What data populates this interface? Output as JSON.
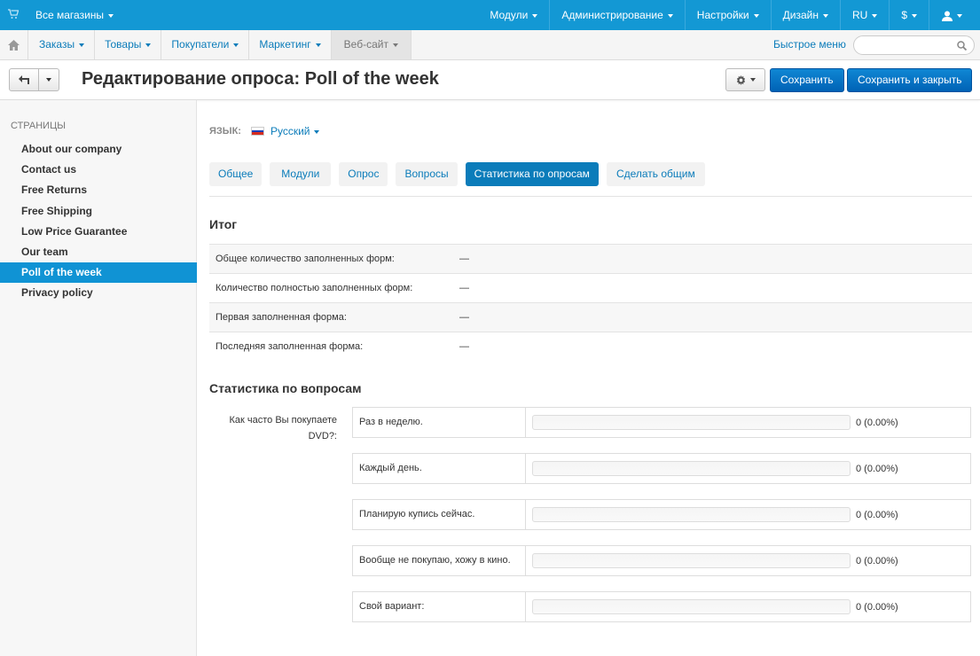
{
  "topbar": {
    "stores_label": "Все магазины",
    "items": [
      {
        "label": "Модули"
      },
      {
        "label": "Администрирование"
      },
      {
        "label": "Настройки"
      },
      {
        "label": "Дизайн"
      },
      {
        "label": "RU"
      },
      {
        "label": "$"
      }
    ]
  },
  "mainnav": {
    "items": [
      {
        "label": "Заказы"
      },
      {
        "label": "Товары"
      },
      {
        "label": "Покупатели"
      },
      {
        "label": "Маркетинг"
      },
      {
        "label": "Веб-сайт"
      }
    ],
    "active_index": 4,
    "quick_menu": "Быстрое меню",
    "search_placeholder": ""
  },
  "header": {
    "title": "Редактирование опроса: Poll of the week",
    "save_label": "Сохранить",
    "save_close_label": "Сохранить и закрыть"
  },
  "sidebar": {
    "heading": "Страницы",
    "items": [
      {
        "label": "About our company"
      },
      {
        "label": "Contact us"
      },
      {
        "label": "Free Returns"
      },
      {
        "label": "Free Shipping"
      },
      {
        "label": "Low Price Guarantee"
      },
      {
        "label": "Our team"
      },
      {
        "label": "Poll of the week"
      },
      {
        "label": "Privacy policy"
      }
    ],
    "active_index": 6
  },
  "content": {
    "lang_label": "Язык:",
    "lang_value": "Русский",
    "tabs": [
      {
        "label": "Общее"
      },
      {
        "label": "Модули"
      },
      {
        "label": "Опрос"
      },
      {
        "label": "Вопросы"
      },
      {
        "label": "Статистика по опросам"
      },
      {
        "label": "Сделать общим"
      }
    ],
    "active_tab": 4,
    "summary_title": "Итог",
    "summary": [
      {
        "key": "Общее количество заполненных форм:",
        "value": "—"
      },
      {
        "key": "Количество полностью заполненных форм:",
        "value": "—"
      },
      {
        "key": "Первая заполненная форма:",
        "value": "—"
      },
      {
        "key": "Последняя заполненная форма:",
        "value": "—"
      }
    ],
    "questions_title": "Статистика по вопросам",
    "question": {
      "label": "Как часто Вы покупаете DVD?:",
      "answers": [
        {
          "text": "Раз в неделю.",
          "result": "0 (0.00%)",
          "fraction": 0
        },
        {
          "text": "Каждый день.",
          "result": "0 (0.00%)",
          "fraction": 0
        },
        {
          "text": "Планирую купись сейчас.",
          "result": "0 (0.00%)",
          "fraction": 0
        },
        {
          "text": "Вообще не покупаю, хожу в кино.",
          "result": "0 (0.00%)",
          "fraction": 0
        },
        {
          "text": "Свой вариант:",
          "result": "0 (0.00%)",
          "fraction": 0
        }
      ]
    }
  },
  "colors": {
    "primary": "#1398d4",
    "link": "#0b7cba",
    "button": "#0b6fc7"
  },
  "icons": [
    "cart-icon",
    "home-icon",
    "search-icon",
    "back-icon",
    "gear-icon",
    "user-icon",
    "flag-ru-icon"
  ]
}
